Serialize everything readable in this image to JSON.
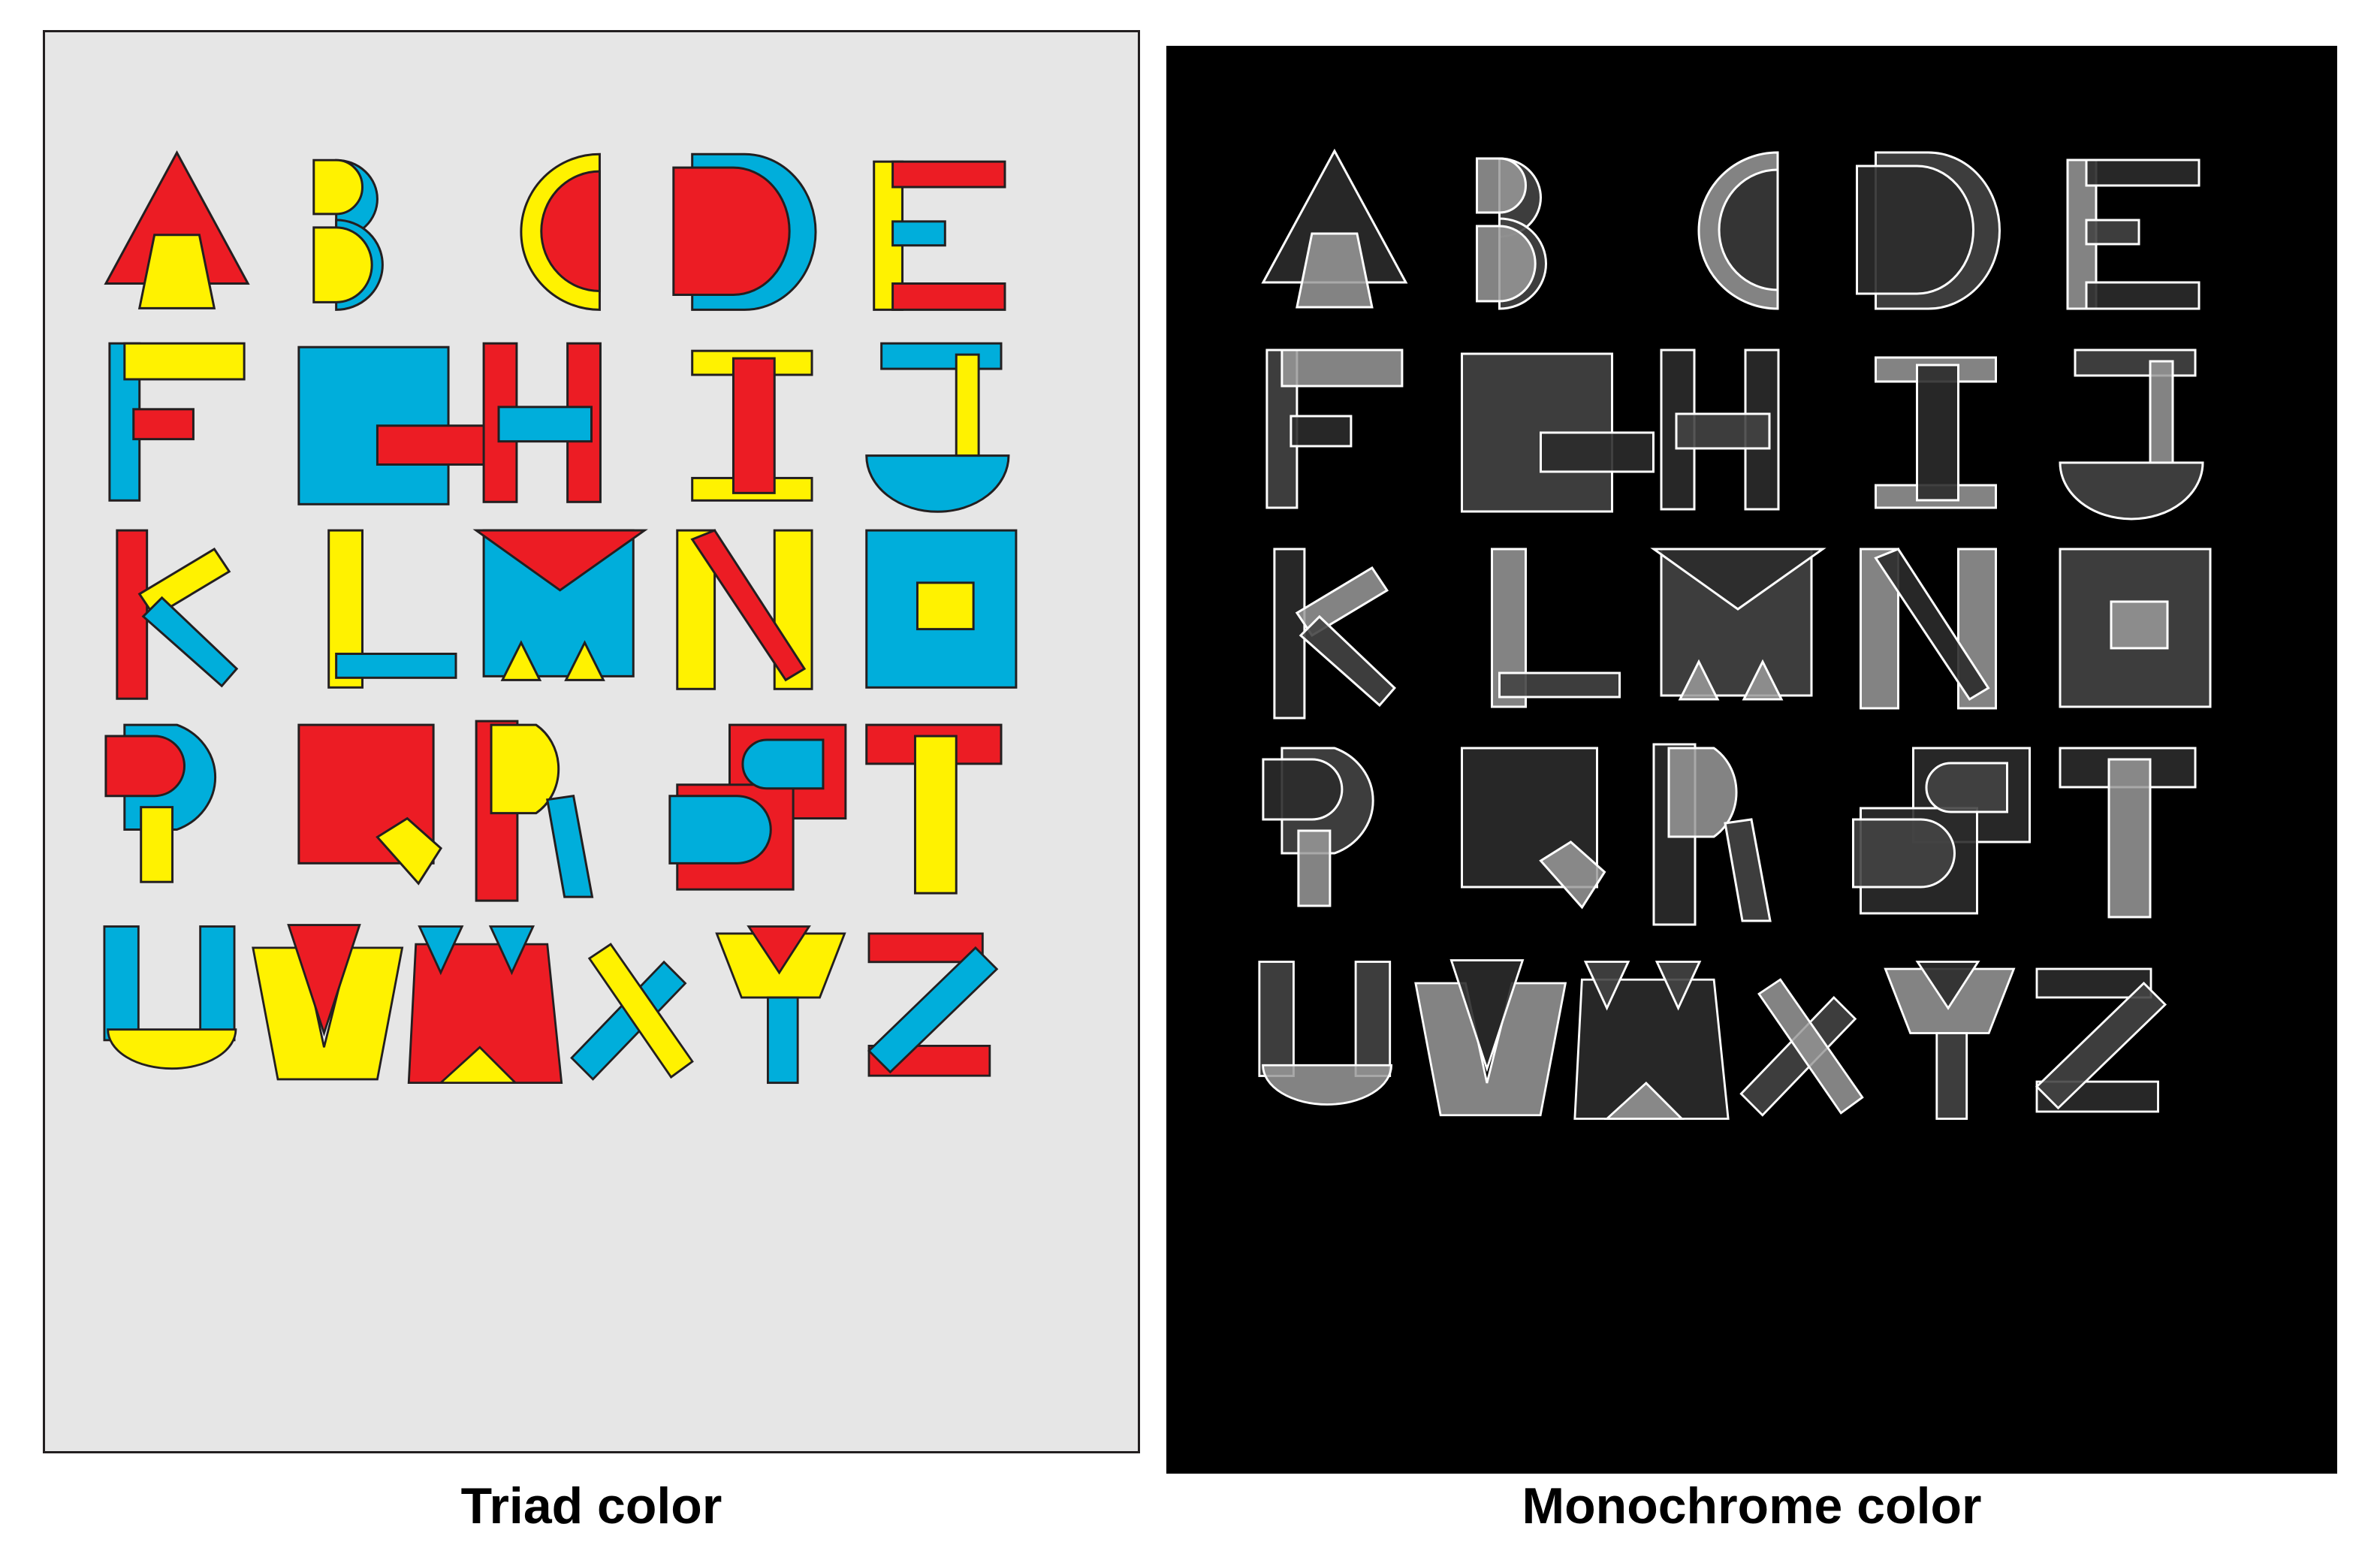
{
  "captions": {
    "left": "Triad color",
    "right": "Monochrome color"
  },
  "letters": [
    "A",
    "B",
    "C",
    "D",
    "E",
    "F",
    "G",
    "H",
    "I",
    "J",
    "K",
    "L",
    "M",
    "N",
    "O",
    "P",
    "Q",
    "R",
    "S",
    "T",
    "U",
    "V",
    "W",
    "X",
    "Y",
    "Z"
  ],
  "palettes": {
    "triad": {
      "background": "#e6e6e6",
      "red": "#ec1c24",
      "yellow": "#fff200",
      "blue": "#00aedb",
      "outline": "#231f20"
    },
    "monochrome": {
      "background": "#000000",
      "dark": "#2b2b2b",
      "mid": "#444444",
      "light": "#9a9a9a",
      "outline": "#ffffff"
    }
  }
}
